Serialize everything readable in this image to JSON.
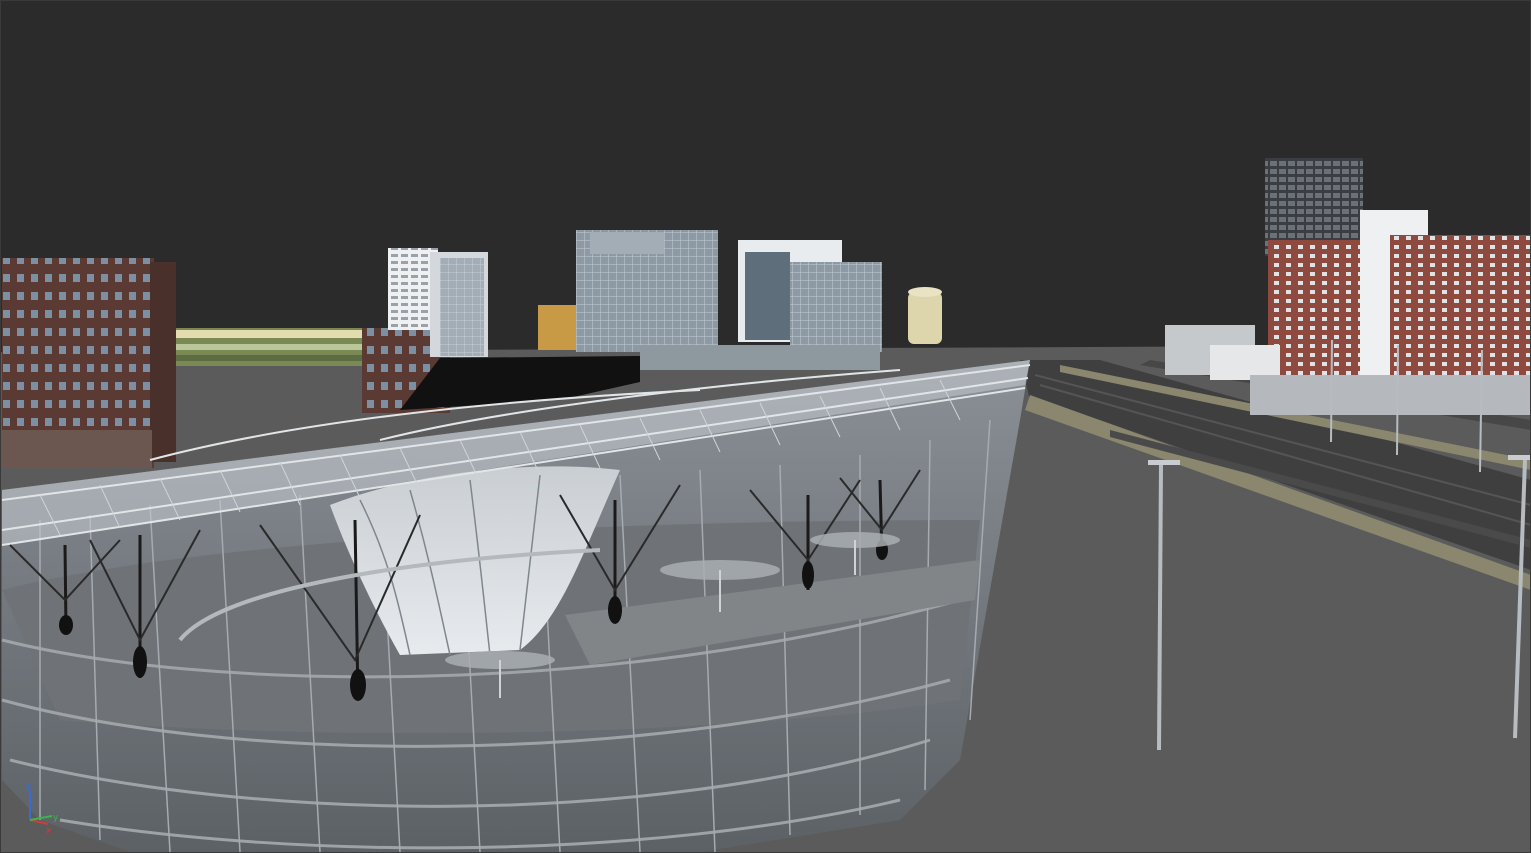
{
  "viewport": {
    "background_color": "#2b2b2b",
    "ground_color": "#5a5a5a",
    "view": "3D perspective"
  },
  "axis_gizmo": {
    "x_label": "x",
    "y_label": "y",
    "z_label": "z",
    "x_color": "#d23b3b",
    "y_color": "#3bb54a",
    "z_color": "#3b6bd2"
  },
  "scene_objects": [
    "brick-office-building-left",
    "low-station-building",
    "white-highrise-center",
    "yellow-historic-building",
    "glass-office-towers",
    "cream-cylindrical-building",
    "steel-truss-stadium",
    "street-lamps",
    "road-network",
    "residential-towers-right"
  ]
}
